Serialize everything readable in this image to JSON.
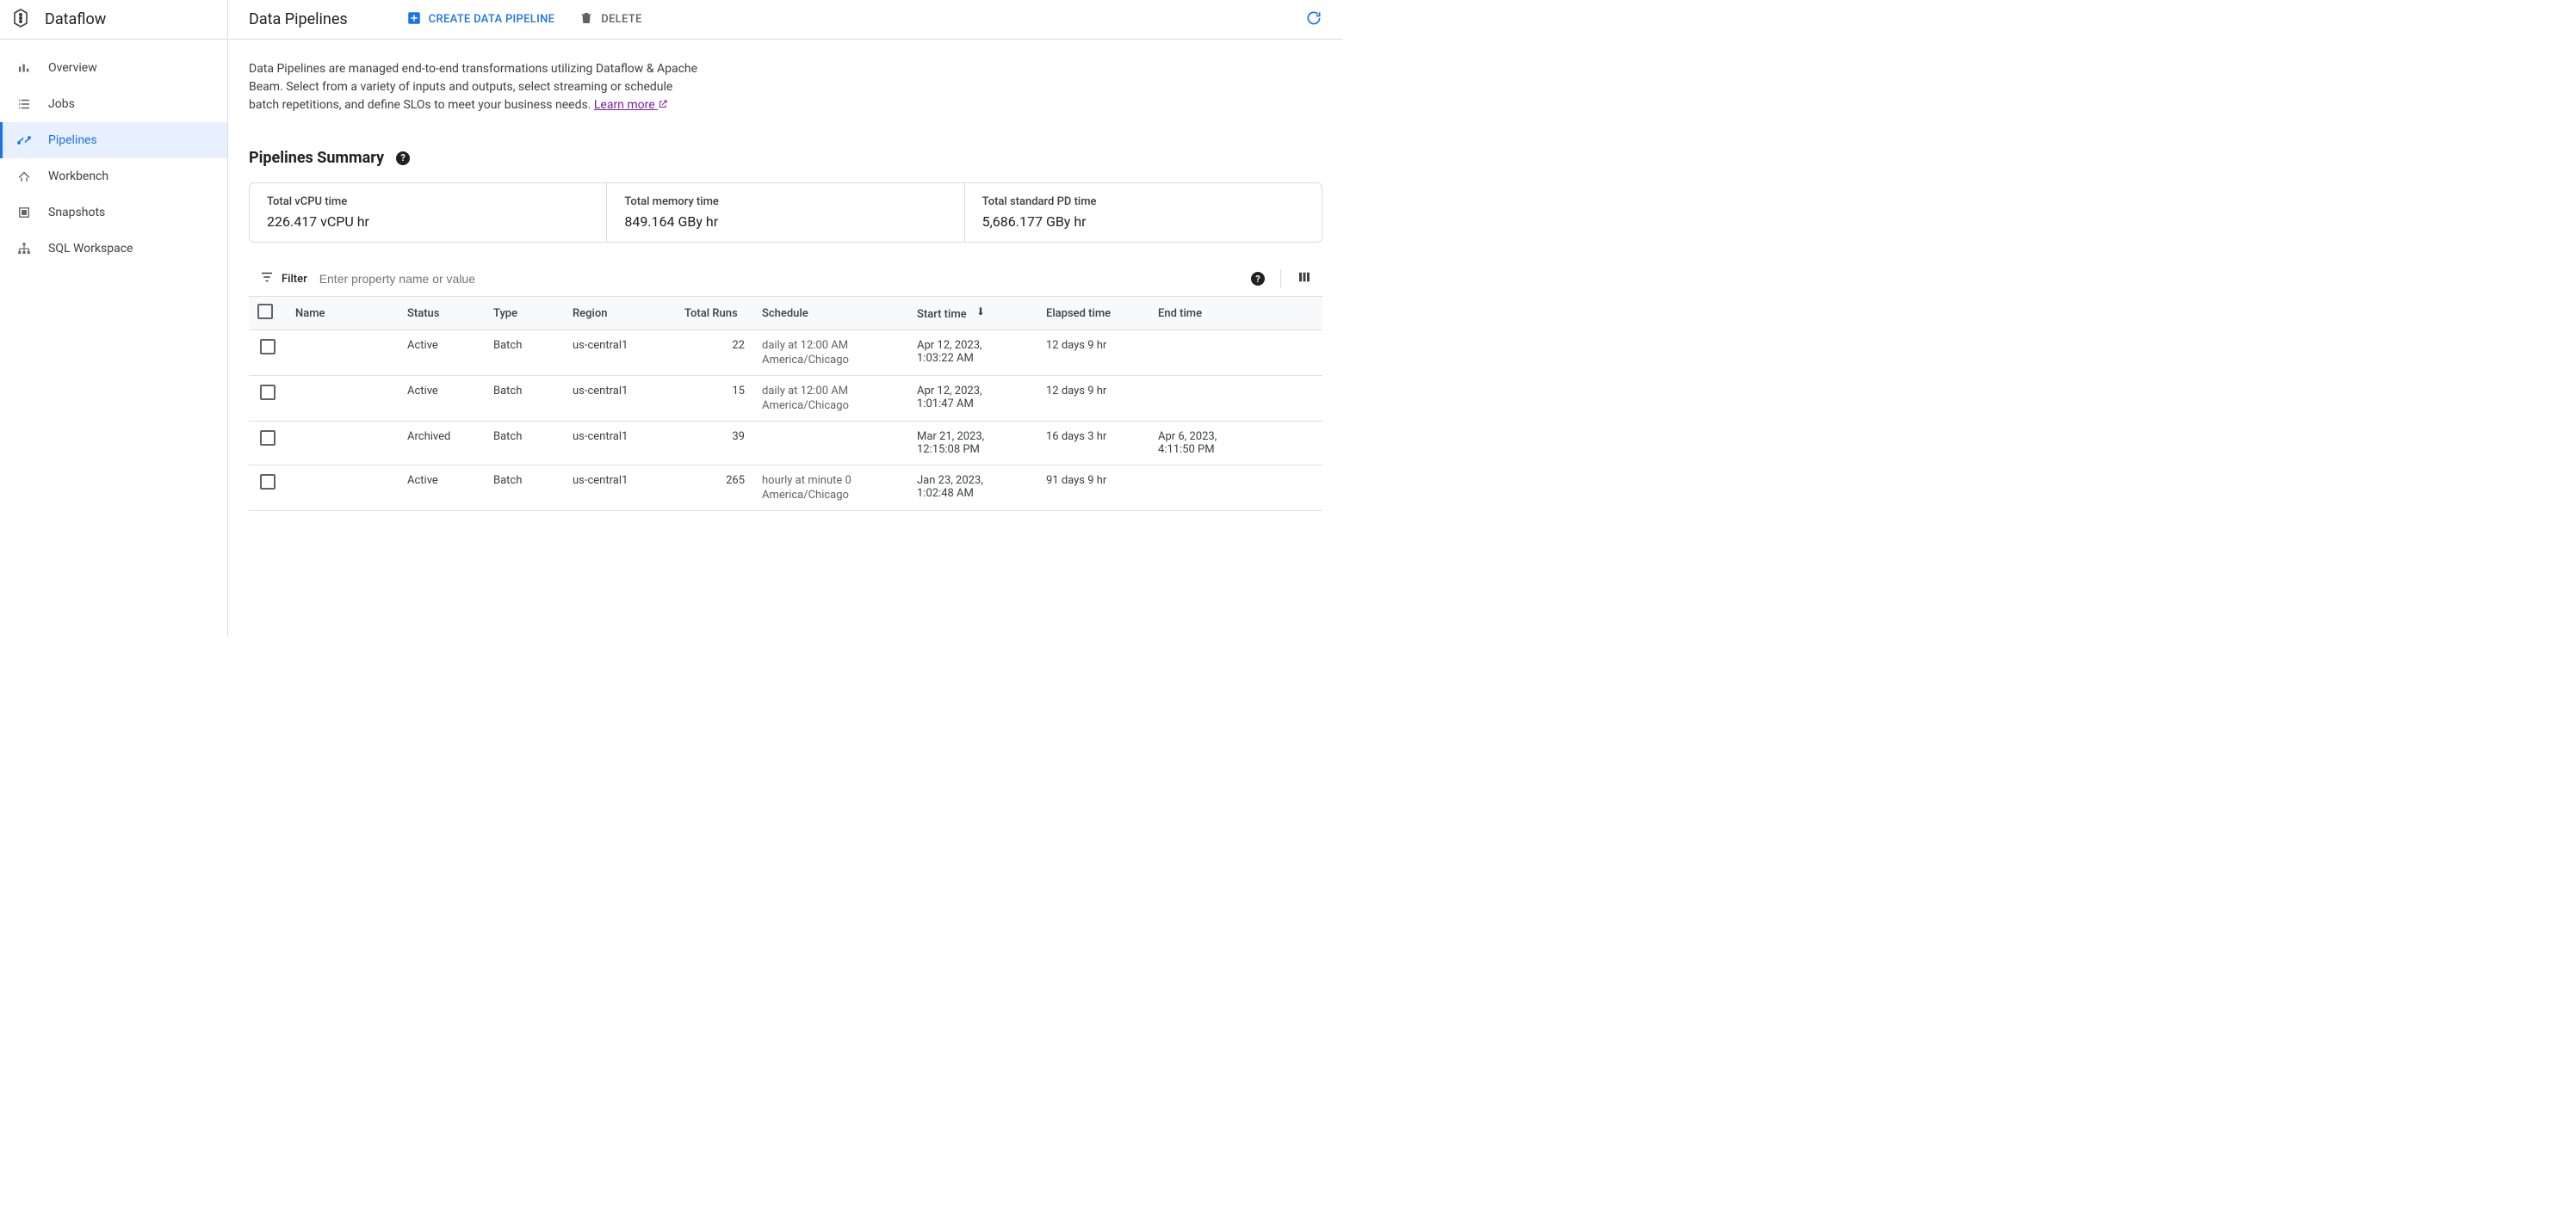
{
  "product": "Dataflow",
  "sidebar": {
    "items": [
      {
        "label": "Overview"
      },
      {
        "label": "Jobs"
      },
      {
        "label": "Pipelines"
      },
      {
        "label": "Workbench"
      },
      {
        "label": "Snapshots"
      },
      {
        "label": "SQL Workspace"
      }
    ]
  },
  "header": {
    "title": "Data Pipelines",
    "create_label": "CREATE DATA PIPELINE",
    "delete_label": "DELETE"
  },
  "description": {
    "text": "Data Pipelines are managed end-to-end transformations utilizing Dataflow & Apache Beam. Select from a variety of inputs and outputs, select streaming or schedule batch repetitions, and define SLOs to meet your business needs. ",
    "link_text": "Learn more"
  },
  "summary": {
    "title": "Pipelines Summary",
    "stats": [
      {
        "label": "Total vCPU time",
        "value": "226.417 vCPU hr"
      },
      {
        "label": "Total memory time",
        "value": "849.164 GBy hr"
      },
      {
        "label": "Total standard PD time",
        "value": "5,686.177 GBy hr"
      }
    ]
  },
  "filter": {
    "label": "Filter",
    "placeholder": "Enter property name or value"
  },
  "table": {
    "columns": {
      "name": "Name",
      "status": "Status",
      "type": "Type",
      "region": "Region",
      "total_runs": "Total Runs",
      "schedule": "Schedule",
      "start_time": "Start time",
      "elapsed_time": "Elapsed time",
      "end_time": "End time"
    },
    "rows": [
      {
        "name": "",
        "status": "Active",
        "type": "Batch",
        "region": "us-central1",
        "total_runs": "22",
        "schedule": "daily at 12:00 AM",
        "schedule_tz": "America/Chicago",
        "start_time_1": "Apr 12, 2023,",
        "start_time_2": "1:03:22 AM",
        "elapsed": "12 days 9 hr",
        "end_time_1": "",
        "end_time_2": ""
      },
      {
        "name": "",
        "status": "Active",
        "type": "Batch",
        "region": "us-central1",
        "total_runs": "15",
        "schedule": "daily at 12:00 AM",
        "schedule_tz": "America/Chicago",
        "start_time_1": "Apr 12, 2023,",
        "start_time_2": "1:01:47 AM",
        "elapsed": "12 days 9 hr",
        "end_time_1": "",
        "end_time_2": ""
      },
      {
        "name": "",
        "status": "Archived",
        "type": "Batch",
        "region": "us-central1",
        "total_runs": "39",
        "schedule": "",
        "schedule_tz": "",
        "start_time_1": "Mar 21, 2023,",
        "start_time_2": "12:15:08 PM",
        "elapsed": "16 days 3 hr",
        "end_time_1": "Apr 6, 2023,",
        "end_time_2": "4:11:50 PM"
      },
      {
        "name": "",
        "status": "Active",
        "type": "Batch",
        "region": "us-central1",
        "total_runs": "265",
        "schedule": "hourly at minute 0",
        "schedule_tz": "America/Chicago",
        "start_time_1": "Jan 23, 2023,",
        "start_time_2": "1:02:48 AM",
        "elapsed": "91 days 9 hr",
        "end_time_1": "",
        "end_time_2": ""
      }
    ]
  }
}
